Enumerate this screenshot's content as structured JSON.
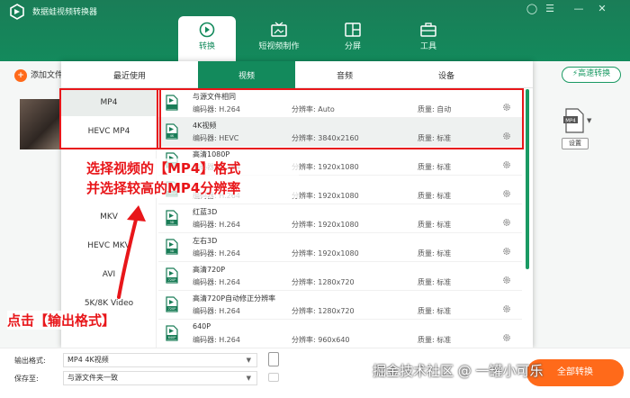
{
  "app": {
    "title": "数据蛙视频转换器"
  },
  "nav": [
    {
      "label": "转换",
      "icon": "convert-icon"
    },
    {
      "label": "短视频制作",
      "icon": "tv-icon"
    },
    {
      "label": "分屏",
      "icon": "split-screen-icon"
    },
    {
      "label": "工具",
      "icon": "toolbox-icon"
    }
  ],
  "main": {
    "add_file_label": "添加文件",
    "fast_convert_label": "高速转换",
    "settings_label": "设置",
    "format_badge": "MP4"
  },
  "popup": {
    "tabs": [
      "最近使用",
      "视频",
      "音频",
      "设备"
    ],
    "sidebar": [
      "MP4",
      "HEVC MP4",
      "MKV",
      "HEVC MKV",
      "AVI",
      "5K/8K Video"
    ],
    "field_labels": {
      "codec": "编码器:",
      "resolution": "分辨率:",
      "quality": "质量:"
    },
    "rows": [
      {
        "name": "与源文件相同",
        "codec": "H.264",
        "resolution": "Auto",
        "quality": "自动",
        "badge": ""
      },
      {
        "name": "4K视频",
        "codec": "HEVC",
        "resolution": "3840x2160",
        "quality": "标准",
        "badge": "4K"
      },
      {
        "name": "高清1080P",
        "codec": "H.264",
        "resolution": "1920x1080",
        "quality": "标准",
        "badge": "1080P"
      },
      {
        "name": "",
        "codec": "H.264",
        "resolution": "1920x1080",
        "quality": "标准",
        "badge": "1080P"
      },
      {
        "name": "红蓝3D",
        "codec": "H.264",
        "resolution": "1920x1080",
        "quality": "标准",
        "badge": "3D"
      },
      {
        "name": "左右3D",
        "codec": "H.264",
        "resolution": "1920x1080",
        "quality": "标准",
        "badge": "3D"
      },
      {
        "name": "高清720P",
        "codec": "H.264",
        "resolution": "1280x720",
        "quality": "标准",
        "badge": "720P"
      },
      {
        "name": "高清720P自动修正分辨率",
        "codec": "H.264",
        "resolution": "1280x720",
        "quality": "标准",
        "badge": "720P"
      },
      {
        "name": "640P",
        "codec": "H.264",
        "resolution": "960x640",
        "quality": "标准",
        "badge": "640P"
      }
    ]
  },
  "annotations": {
    "line1": "选择视频的【MP4】格式",
    "line2": "并选择较高的MP4分辨率",
    "output_hint": "点击【输出格式】"
  },
  "bottom": {
    "output_label": "输出格式:",
    "output_value": "MP4 4K视频",
    "save_label": "保存至:",
    "save_value": "与源文件夹一致",
    "convert_all_label": "全部转换"
  },
  "watermark": "掘金技术社区 @ 一罐小可乐",
  "colors": {
    "brand": "#138a5c",
    "accent": "#ff6a1a",
    "annotation": "#e8161a"
  }
}
